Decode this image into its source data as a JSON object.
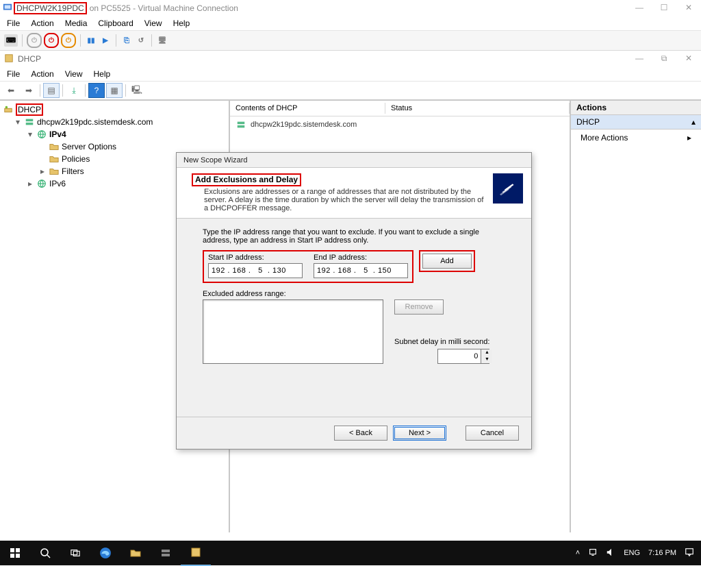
{
  "vmc": {
    "title_highlighted_host": "DHCPW2K19PDC",
    "title_rest": "on PC5525 - Virtual Machine Connection",
    "menu": [
      "File",
      "Action",
      "Media",
      "Clipboard",
      "View",
      "Help"
    ]
  },
  "dhcp": {
    "title": "DHCP",
    "menu": [
      "File",
      "Action",
      "View",
      "Help"
    ]
  },
  "tree": {
    "root": "DHCP",
    "server": "dhcpw2k19pdc.sistemdesk.com",
    "ipv4": "IPv4",
    "ipv4_children": [
      "Server Options",
      "Policies",
      "Filters"
    ],
    "ipv6": "IPv6"
  },
  "content": {
    "header_col1": "Contents of DHCP",
    "header_col2": "Status",
    "row_server": "dhcpw2k19pdc.sistemdesk.com"
  },
  "actions": {
    "header": "Actions",
    "group": "DHCP",
    "items": [
      "More Actions"
    ]
  },
  "wizard": {
    "caption": "New Scope Wizard",
    "heading": "Add Exclusions and Delay",
    "heading_desc": "Exclusions are addresses or a range of addresses that are not distributed by the server. A delay is the time duration by which the server will delay the transmission of a DHCPOFFER message.",
    "instructions": "Type the IP address range that you want to exclude. If you want to exclude a single address, type an address in Start IP address only.",
    "start_ip_label": "Start IP address:",
    "end_ip_label": "End IP address:",
    "start_ip_value": "192 . 168 .   5  . 130",
    "end_ip_value": "192 . 168 .   5  . 150",
    "add_label": "Add",
    "excluded_label": "Excluded address range:",
    "remove_label": "Remove",
    "delay_label": "Subnet delay in milli second:",
    "delay_value": "0",
    "back_label": "< Back",
    "next_label": "Next >",
    "cancel_label": "Cancel"
  },
  "taskbar": {
    "lang": "ENG",
    "time": "7:16 PM"
  }
}
